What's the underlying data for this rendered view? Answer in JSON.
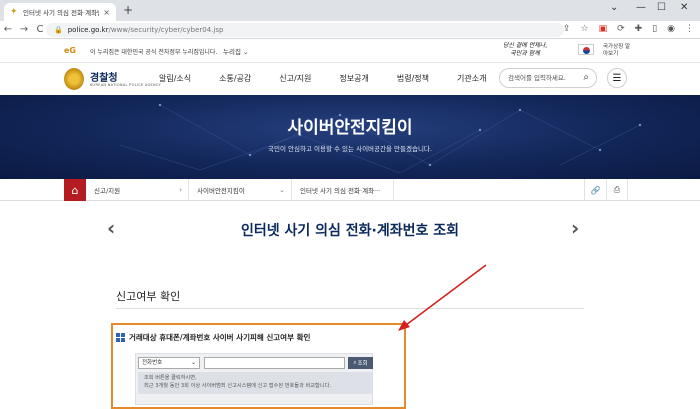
{
  "browser": {
    "tab_title": "인터넷 사기 의심 전화·계좌번호",
    "tab_close": "×",
    "new_tab": "+",
    "url_host": "police.go.kr",
    "url_path": "/www/security/cyber/cyber04.jsp",
    "window_controls": {
      "chevron": "⌄",
      "minimize": "—",
      "maximize": "☐",
      "close": "✕"
    },
    "nav": {
      "back": "←",
      "forward": "→",
      "reload": "C"
    }
  },
  "gov_bar": {
    "logo": "eG",
    "text": "이 누리집은 대한민국 공식 전자정부 누리집입니다.",
    "more_label": "누리집",
    "slogan": "당신 곁에 언제나, 국민과 함께",
    "flag_label": "국가상징 알아보기"
  },
  "header": {
    "org_name": "경찰청",
    "org_sub": "KOREAN NATIONAL POLICE AGENCY",
    "gnb": [
      "알림/소식",
      "소통/공감",
      "신고/지원",
      "정보공개",
      "법령/정책",
      "기관소개"
    ],
    "search_placeholder": "검색어를 입력하세요."
  },
  "banner": {
    "title": "사이버안전지킴이",
    "subtitle": "국민이 안심하고 이용할 수 있는 사이버공간을 만들겠습니다."
  },
  "breadcrumb": {
    "items": [
      "신고/지원",
      "사이버안전지킴이",
      "인터넷 사기 의심 전화·계좌···"
    ]
  },
  "page": {
    "title": "인터넷 사기 의심 전화·계좌번호 조회",
    "section_title": "신고여부 확인"
  },
  "check_panel": {
    "heading": "거래대상 휴대폰/계좌번호 사이버 사기피해 신고여부 확인",
    "select_value": "전화번호",
    "search_button": "조회",
    "info_line1": "조회 버튼을 클릭하시면,",
    "info_line2": "최근 3개월 동안 3회 이상 사이버범죄 신고시스템에 신고 접수된 번호들과 비교합니다."
  },
  "colors": {
    "accent_red": "#b41c22",
    "navy": "#0b2a5b",
    "highlight_orange": "#e58a2a",
    "arrow_red": "#d42020"
  }
}
